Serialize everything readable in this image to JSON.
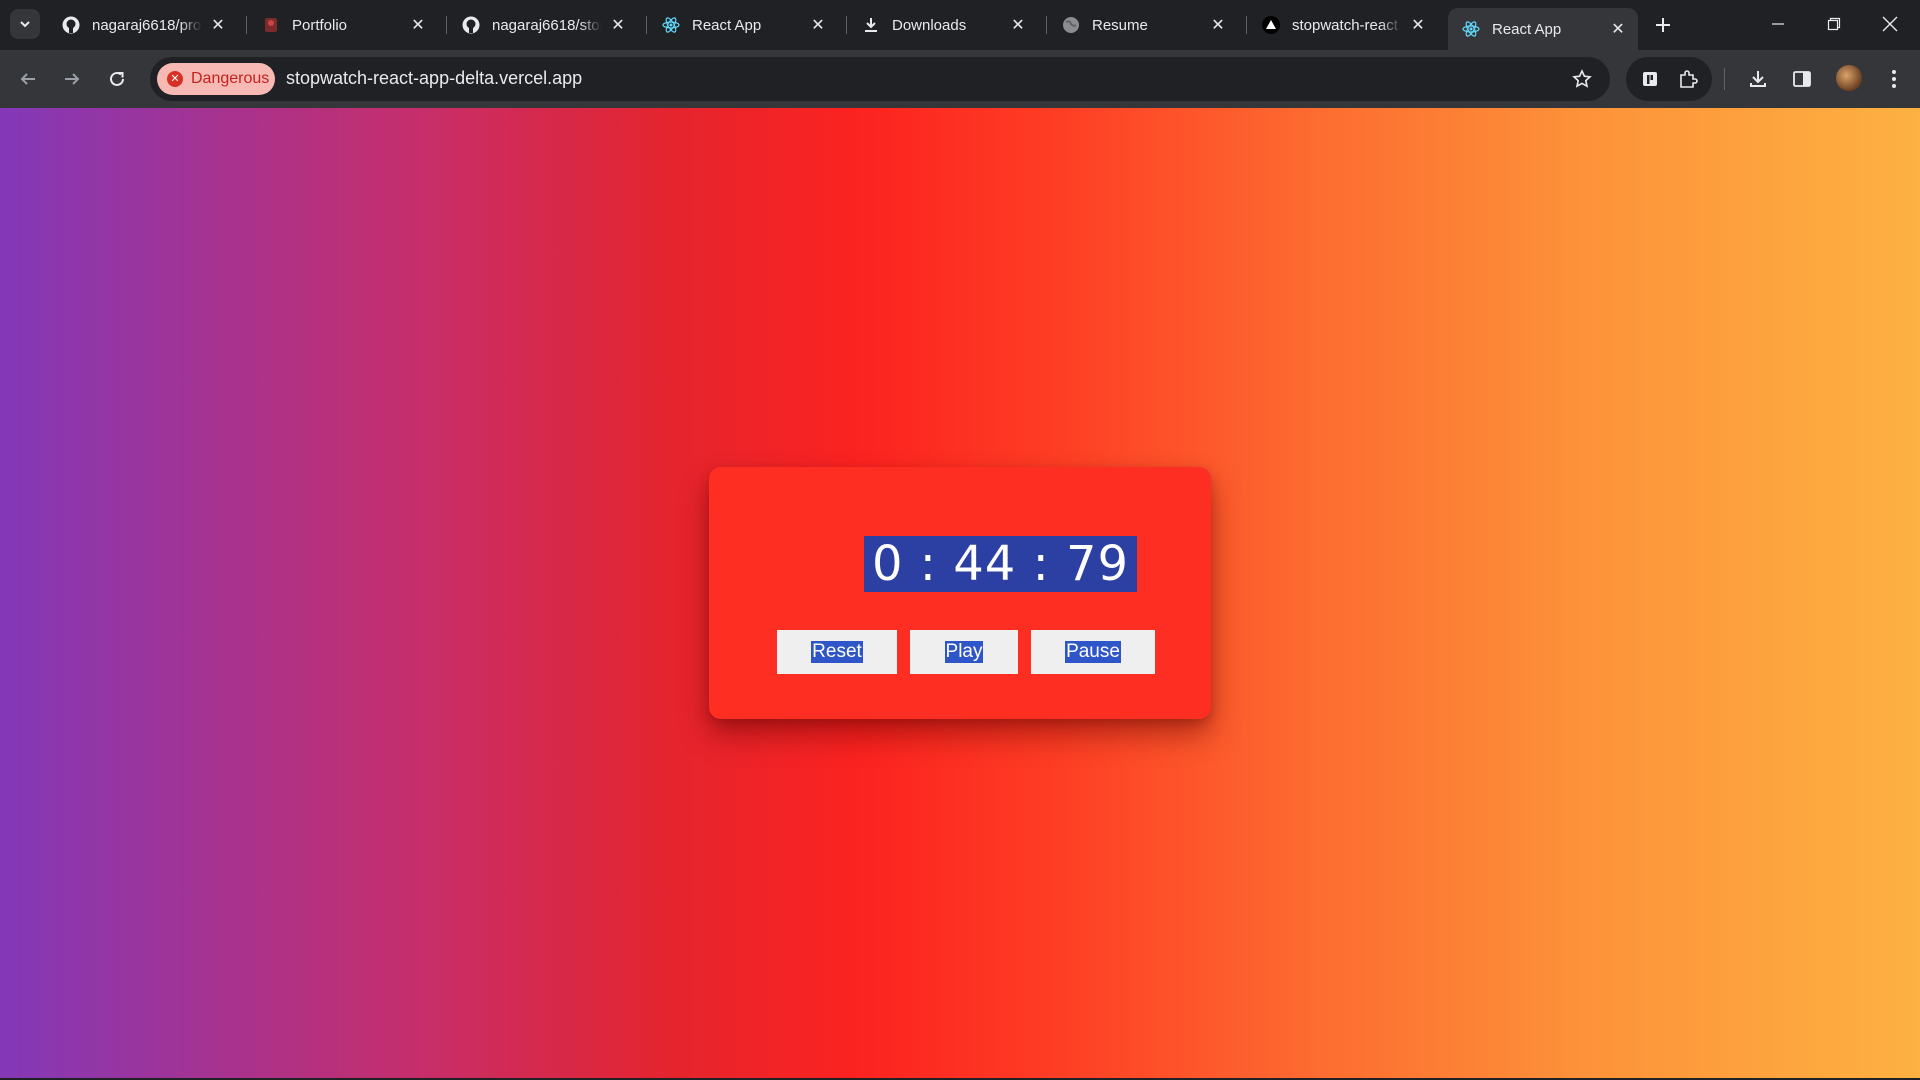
{
  "browser": {
    "tabs": [
      {
        "title": "nagaraj6618/pro",
        "icon": "github-icon",
        "active": false
      },
      {
        "title": "Portfolio",
        "icon": "portfolio-icon",
        "active": false
      },
      {
        "title": "nagaraj6618/stop",
        "icon": "github-icon",
        "active": false
      },
      {
        "title": "React App",
        "icon": "react-icon",
        "active": false
      },
      {
        "title": "Downloads",
        "icon": "download-icon",
        "active": false
      },
      {
        "title": "Resume",
        "icon": "globe-icon",
        "active": false
      },
      {
        "title": "stopwatch-react",
        "icon": "vercel-icon",
        "active": false
      },
      {
        "title": "React App",
        "icon": "react-icon",
        "active": true
      }
    ],
    "security_chip": "Dangerous",
    "url": "stopwatch-react-app-delta.vercel.app"
  },
  "stopwatch": {
    "time_display": "0 : 44 : 79",
    "buttons": {
      "reset": "Reset",
      "play": "Play",
      "pause": "Pause"
    }
  },
  "colors": {
    "card_background": "#fe2e22",
    "selection_highlight": "#2c3fa3",
    "danger": "#d93025",
    "gradient_start": "#8338b8",
    "gradient_mid": "#fc2320",
    "gradient_end": "#fdb142"
  }
}
